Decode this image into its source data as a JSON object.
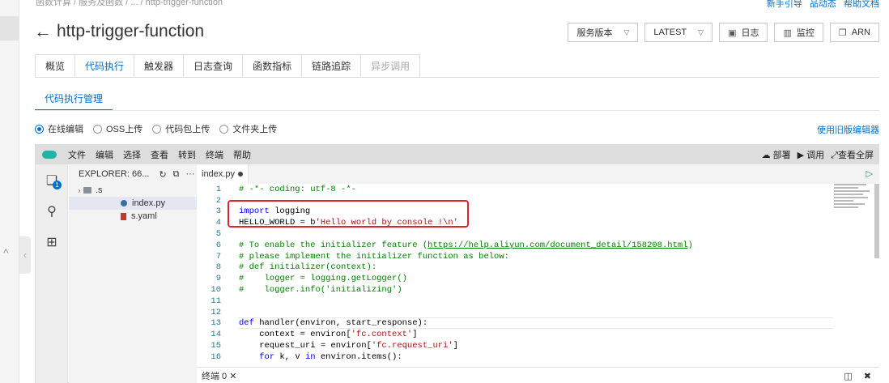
{
  "breadcrumb": "函数计算 / 服务及函数 / ... / http-trigger-function",
  "top_links": [
    "新手引导",
    "品动态",
    "帮助文档"
  ],
  "page_title": "http-trigger-function",
  "actions": {
    "version_label": "服务版本",
    "latest_label": "LATEST",
    "log_label": "日志",
    "monitor_label": "监控",
    "arn_label": "ARN"
  },
  "tabs": [
    {
      "label": "概览"
    },
    {
      "label": "代码执行"
    },
    {
      "label": "触发器"
    },
    {
      "label": "日志查询"
    },
    {
      "label": "函数指标"
    },
    {
      "label": "链路追踪"
    },
    {
      "label": "异步调用"
    }
  ],
  "subtab": "代码执行管理",
  "upload_options": [
    {
      "label": "在线编辑",
      "checked": true
    },
    {
      "label": "OSS上传",
      "checked": false
    },
    {
      "label": "代码包上传",
      "checked": false
    },
    {
      "label": "文件夹上传",
      "checked": false
    }
  ],
  "old_editor_link": "使用旧版编辑器",
  "ide": {
    "menu": [
      "文件",
      "编辑",
      "选择",
      "查看",
      "转到",
      "终端",
      "帮助"
    ],
    "deploy_label": "部署",
    "debug_label": "调用",
    "fullscreen_label": "查看全屏",
    "explorer_title": "EXPLORER: 66...",
    "files_badge": "1",
    "tree": [
      {
        "name": ".s",
        "type": "folder"
      },
      {
        "name": "index.py",
        "type": "python"
      },
      {
        "name": "s.yaml",
        "type": "yaml"
      }
    ],
    "open_tab": "index.py",
    "terminal_label": "终端 0"
  },
  "code_lines": [
    {
      "n": "1",
      "html": "<span class='cm'># -*- coding: utf-8 -*-</span>"
    },
    {
      "n": "2",
      "html": ""
    },
    {
      "n": "3",
      "html": "<span class='kw'>import</span> logging"
    },
    {
      "n": "4",
      "html": "HELLO_WORLD = b<span class='st'>'Hello world by console !\\n'</span>"
    },
    {
      "n": "5",
      "html": ""
    },
    {
      "n": "6",
      "html": "<span class='cm'># To enable the initializer feature (<span class='ul'>https://help.aliyun.com/document_detail/158208.html</span>)</span>"
    },
    {
      "n": "7",
      "html": "<span class='cm'># please implement the initializer function as below:</span>"
    },
    {
      "n": "8",
      "html": "<span class='cm'># def initializer(context):</span>"
    },
    {
      "n": "9",
      "html": "<span class='cm'>#    logger = logging.getLogger()</span>"
    },
    {
      "n": "10",
      "html": "<span class='cm'>#    logger.info('initializing')</span>"
    },
    {
      "n": "11",
      "html": ""
    },
    {
      "n": "12",
      "html": ""
    },
    {
      "n": "13",
      "html": "<span class='kw'>def</span> handler(environ, start_response):"
    },
    {
      "n": "14",
      "html": "    context = environ[<span class='st'>'fc.context'</span>]"
    },
    {
      "n": "15",
      "html": "    request_uri = environ[<span class='st'>'fc.request_uri'</span>]"
    },
    {
      "n": "16",
      "html": "    <span class='kw'>for</span> k, v <span class='kw'>in</span> environ.items():"
    }
  ]
}
